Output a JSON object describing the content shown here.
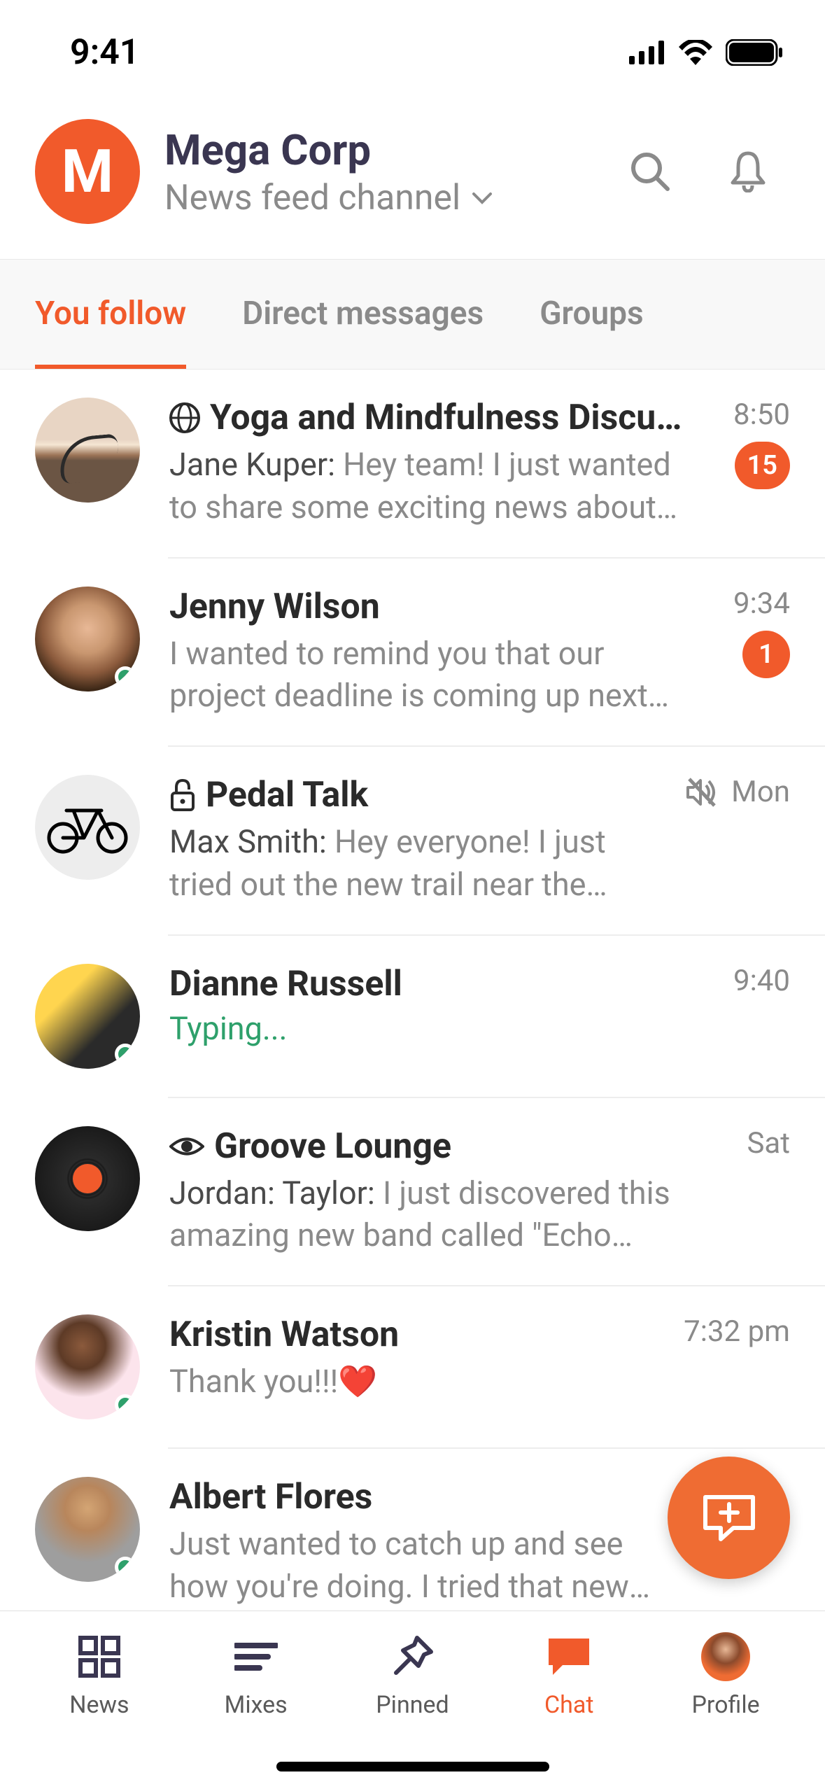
{
  "status": {
    "time": "9:41"
  },
  "header": {
    "org_initial": "M",
    "org_name": "Mega Corp",
    "channel_label": "News feed channel"
  },
  "tabs": {
    "you_follow": "You follow",
    "direct_messages": "Direct messages",
    "groups": "Groups"
  },
  "chats": [
    {
      "title": "Yoga and Mindfulness Discussi...",
      "time": "8:50",
      "sender": "Jane Kuper: ",
      "preview": "Hey team! I just wanted to share some exciting news about our sp...",
      "badge": "15",
      "public": true
    },
    {
      "title": "Jenny Wilson",
      "time": "9:34",
      "preview": "I wanted to remind you that our project deadline is coming up next Friday.",
      "badge": "1",
      "presence": true
    },
    {
      "title": "Pedal Talk",
      "time": "Mon",
      "sender": "Max Smith: ",
      "preview": "Hey everyone! I just tried out the new trail near the river, and it's fantastic! 🚴",
      "locked": true,
      "muted": true
    },
    {
      "title": "Dianne Russell",
      "time": "9:40",
      "typing": "Typing...",
      "presence": true
    },
    {
      "title": "Groove Lounge",
      "time": "Sat",
      "sender": "Jordan: Taylor: ",
      "preview": "I just discovered this amazing  new band called \"Echo Waves.\"",
      "eye": true
    },
    {
      "title": "Kristin Watson",
      "time": "7:32 pm",
      "preview": "Thank you!!!❤️",
      "presence": true
    },
    {
      "title": "Albert Flores",
      "preview": "Just wanted to catch up and see how you're doing.  I tried that new coffee place we talked",
      "presence": true
    }
  ],
  "nav": {
    "news": "News",
    "mixes": "Mixes",
    "pinned": "Pinned",
    "chat": "Chat",
    "profile": "Profile"
  }
}
